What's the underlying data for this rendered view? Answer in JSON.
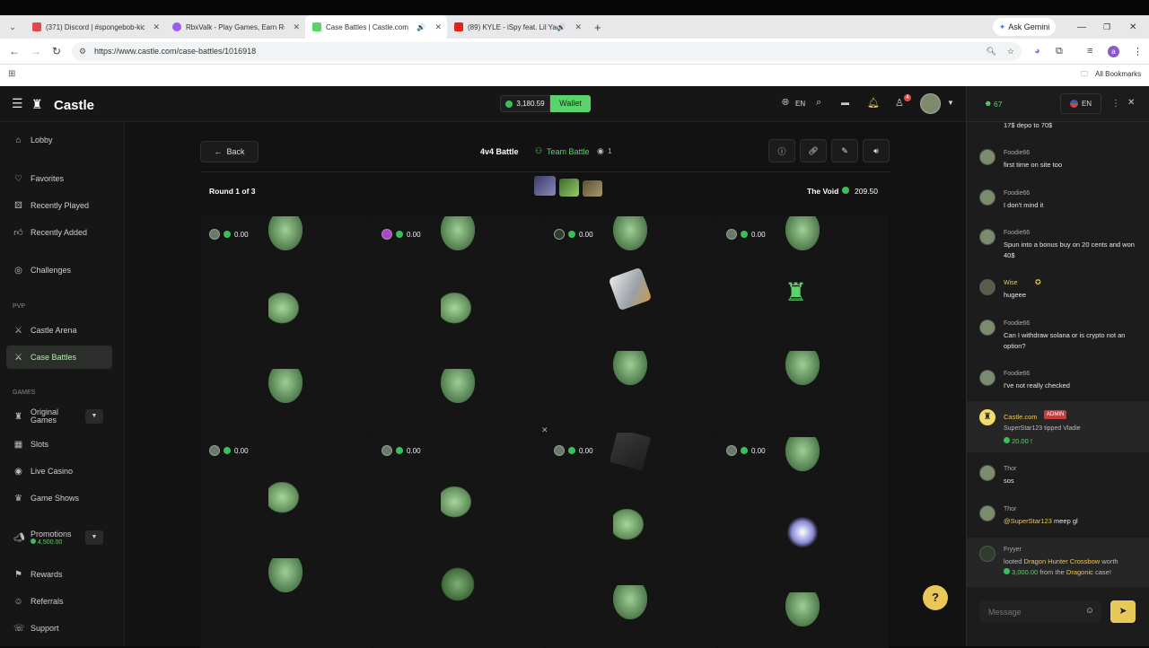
{
  "browser": {
    "tabs": [
      {
        "title": "(371) Discord | #spongebob-kic",
        "color": "#e2474b"
      },
      {
        "title": "RbxValk - Play Games, Earn Rew",
        "color": "#9c5cf0"
      },
      {
        "title": "Case Battles | Castle.com",
        "color": "#5bd36b"
      },
      {
        "title": "(89) KYLE - iSpy feat. Lil Yac",
        "color": "#e62117"
      }
    ],
    "ask_gemini": "Ask Gemini",
    "url": "https://www.castle.com/case-battles/1016918",
    "bookmarks": "All Bookmarks",
    "profile_initial": "a"
  },
  "header": {
    "brand": "Castle",
    "balance": "3,180.59",
    "wallet_label": "Wallet",
    "language": "EN",
    "notification_count": "4"
  },
  "sidebar": {
    "items": [
      {
        "label": "Lobby",
        "icon": "house-icon"
      },
      {
        "label": "Favorites",
        "icon": "heart-icon"
      },
      {
        "label": "Recently Played",
        "icon": "dice-icon"
      },
      {
        "label": "Recently Added",
        "icon": "thumb-icon"
      },
      {
        "label": "Challenges",
        "icon": "target-icon"
      }
    ],
    "pvp_title": "PVP",
    "pvp_items": [
      {
        "label": "Castle Arena"
      },
      {
        "label": "Case Battles"
      }
    ],
    "games_title": "GAMES",
    "games_items": [
      {
        "label": "Original Games"
      },
      {
        "label": "Slots"
      },
      {
        "label": "Live Casino"
      },
      {
        "label": "Game Shows"
      }
    ],
    "promotions_label": "Promotions",
    "promotions_value": "4,500.00",
    "bottom_items": [
      {
        "label": "Rewards"
      },
      {
        "label": "Referrals"
      },
      {
        "label": "Support"
      }
    ]
  },
  "battle": {
    "back_label": "Back",
    "mode": "4v4 Battle",
    "team_label": "Team Battle",
    "viewers": "1",
    "round_label": "Round",
    "round_value": "1 of 3",
    "case_name": "The Void",
    "case_price": "209.50",
    "slots_top": [
      "0.00",
      "0.00",
      "0.00",
      "0.00"
    ],
    "slots_bottom": [
      "0.00",
      "0.00",
      "0.00",
      "0.00"
    ]
  },
  "chat": {
    "online": "67",
    "language": "EN",
    "messages": [
      {
        "name": "",
        "text": "17$ depo to 70$"
      },
      {
        "name": "Foodie66",
        "text": "first time on site too"
      },
      {
        "name": "Foodie66",
        "text": "I don't mind it"
      },
      {
        "name": "Foodie66",
        "text": "Spun into a bonus buy on 20 cents and won 40$"
      },
      {
        "name": "Wise",
        "text": "hugeee"
      },
      {
        "name": "Foodie66",
        "text": "Can I withdraw solana or is crypto not an option?"
      },
      {
        "name": "Foodie66",
        "text": "I've not really checked"
      }
    ],
    "admin": {
      "name": "Castle.com",
      "badge": "ADMIN",
      "tipper": "SuperStar123",
      "verb": "tipped",
      "target": "Vladie",
      "amount": "20.00 !"
    },
    "messages2": [
      {
        "name": "Thor",
        "text": "sos"
      },
      {
        "name": "Thor",
        "mention": "@SuperStar123",
        "text": "meep gl"
      }
    ],
    "drop": {
      "name": "Fryyer",
      "pre": "looted",
      "item": "Dragon Hunter Crossbow",
      "mid": "worth",
      "value": "3,000.00",
      "from": "from the",
      "case": "Dragonic",
      "post": "case!"
    },
    "placeholder": "Message"
  },
  "colors": {
    "accent": "#5bd36b",
    "bg": "#121212",
    "gold": "#e9c85a"
  }
}
